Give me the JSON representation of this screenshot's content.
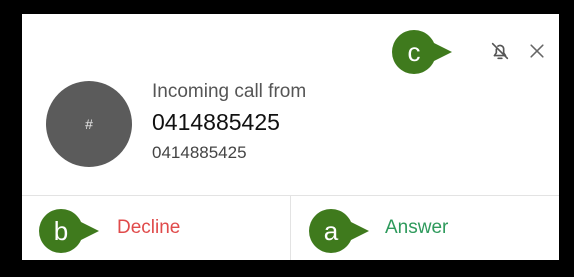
{
  "notification": {
    "avatar_text": "#",
    "incoming_label": "Incoming call from",
    "caller_name": "0414885425",
    "caller_number": "0414885425"
  },
  "actions": {
    "decline_label": "Decline",
    "answer_label": "Answer"
  },
  "markers": {
    "a": "a",
    "b": "b",
    "c": "c"
  },
  "colors": {
    "decline": "#e04b4b",
    "answer": "#2e9a5c",
    "marker": "#3f7a1d"
  },
  "icons": {
    "mute": "bell-off-icon",
    "close": "close-icon"
  }
}
